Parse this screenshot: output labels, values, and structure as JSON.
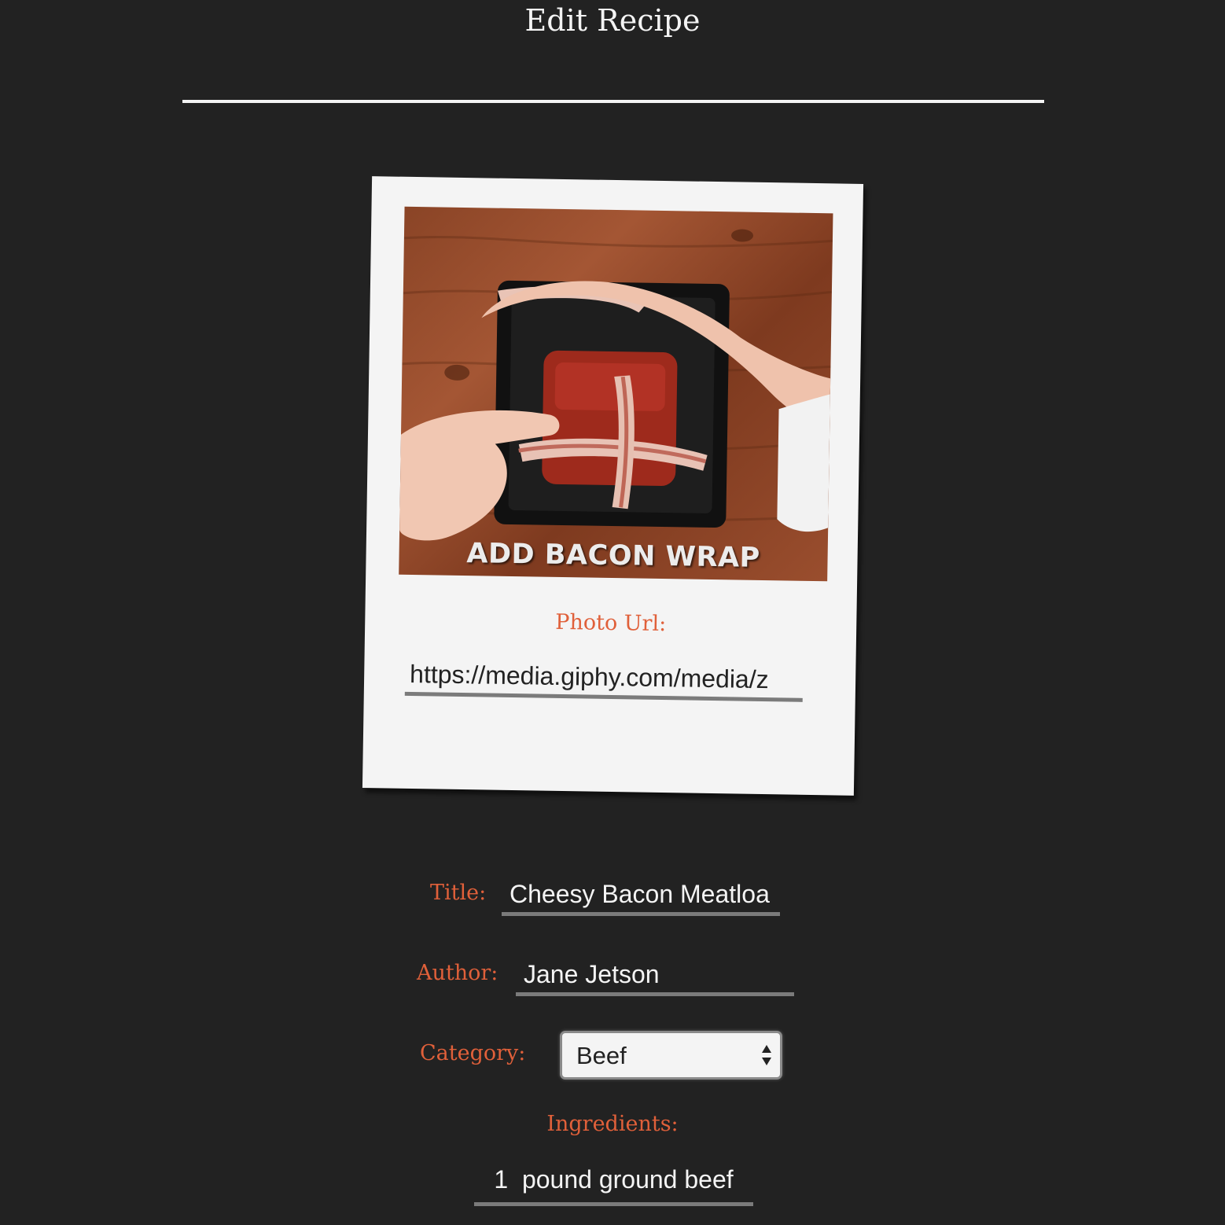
{
  "header": {
    "title": "Edit Recipe"
  },
  "photo": {
    "caption": "ADD BACON WRAP",
    "url_label": "Photo Url:",
    "url_value": "https://media.giphy.com/media/z"
  },
  "form": {
    "title_label": "Title:",
    "title_value": "Cheesy Bacon Meatloa",
    "author_label": "Author:",
    "author_value": "Jane Jetson",
    "category_label": "Category:",
    "category_value": "Beef",
    "ingredients_label": "Ingredients:",
    "ingredients": [
      {
        "quantity": "1",
        "description": "pound ground beef"
      }
    ]
  },
  "colors": {
    "background": "#222222",
    "accent": "#e0603a",
    "card": "#f4f4f4",
    "underline": "#7b7b7b"
  }
}
